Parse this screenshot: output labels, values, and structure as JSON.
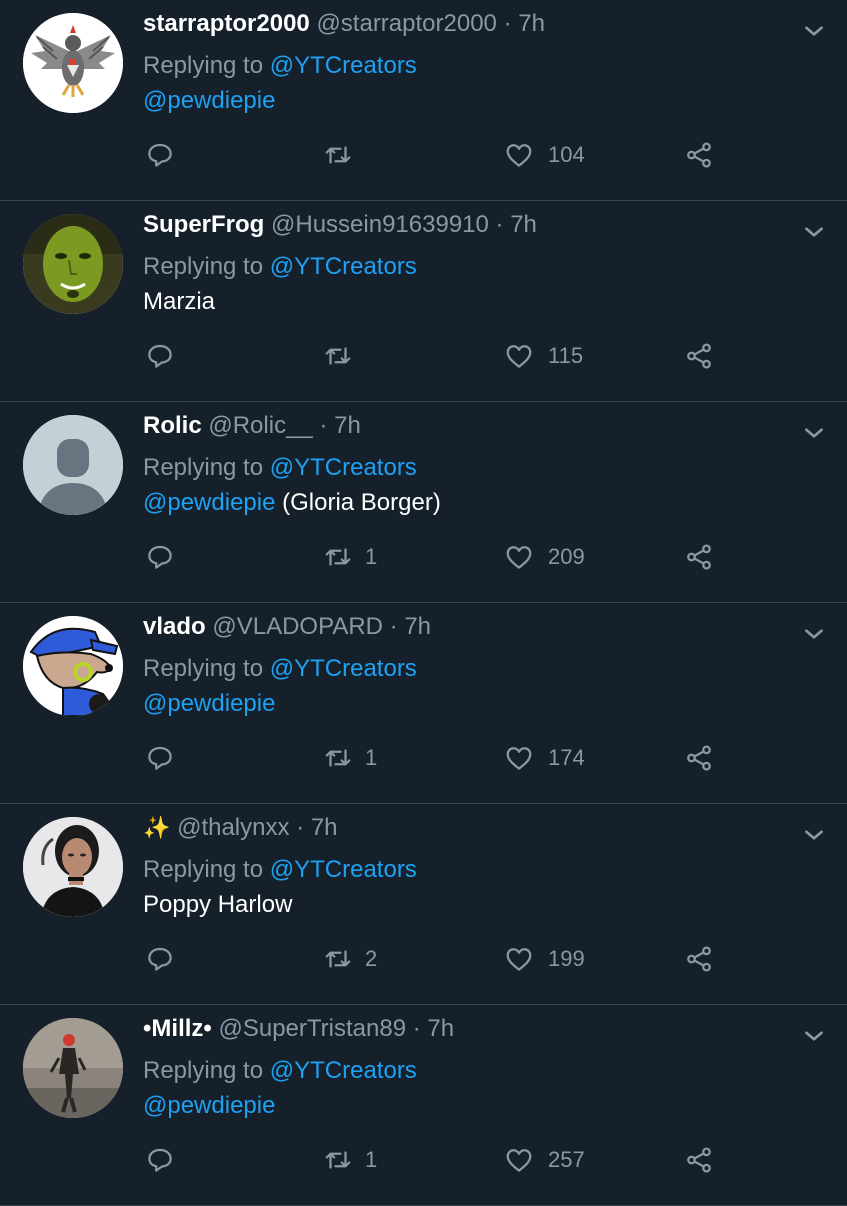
{
  "replying_prefix": "Replying to",
  "tweets": [
    {
      "name": "starraptor2000",
      "handle": "@starraptor2000",
      "time": "· 7h",
      "replying_to": "@YTCreators",
      "body_link": "@pewdiepie",
      "body_text": "",
      "retweets": "",
      "likes": "104",
      "avatar": "eagle-avatar"
    },
    {
      "name": "SuperFrog",
      "handle": "@Hussein91639910",
      "time": "· 7h",
      "replying_to": "@YTCreators",
      "body_link": "",
      "body_text": "Marzia",
      "retweets": "",
      "likes": "115",
      "avatar": "green-face-avatar"
    },
    {
      "name": "Rolic",
      "handle": "@Rolic__",
      "time": "· 7h",
      "replying_to": "@YTCreators",
      "body_link": "@pewdiepie",
      "body_text": " (Gloria Borger)",
      "retweets": "1",
      "likes": "209",
      "avatar": "default-avatar"
    },
    {
      "name": "vlado",
      "handle": "@VLADOPARD",
      "time": "· 7h",
      "replying_to": "@YTCreators",
      "body_link": "@pewdiepie",
      "body_text": "",
      "retweets": "1",
      "likes": "174",
      "avatar": "cartoon-animal-avatar"
    },
    {
      "name": "✨",
      "handle": "@thalynxx",
      "time": "· 7h",
      "replying_to": "@YTCreators",
      "body_link": "",
      "body_text": "Poppy Harlow",
      "retweets": "2",
      "likes": "199",
      "avatar": "person-photo-avatar"
    },
    {
      "name": "•Millz•",
      "handle": "@SuperTristan89",
      "time": "· 7h",
      "replying_to": "@YTCreators",
      "body_link": "@pewdiepie",
      "body_text": "",
      "retweets": "1",
      "likes": "257",
      "avatar": "figure-photo-avatar"
    }
  ],
  "colors": {
    "background": "#15202b",
    "divider": "#38444d",
    "secondary_text": "#8899a6",
    "link": "#1da1f2"
  }
}
